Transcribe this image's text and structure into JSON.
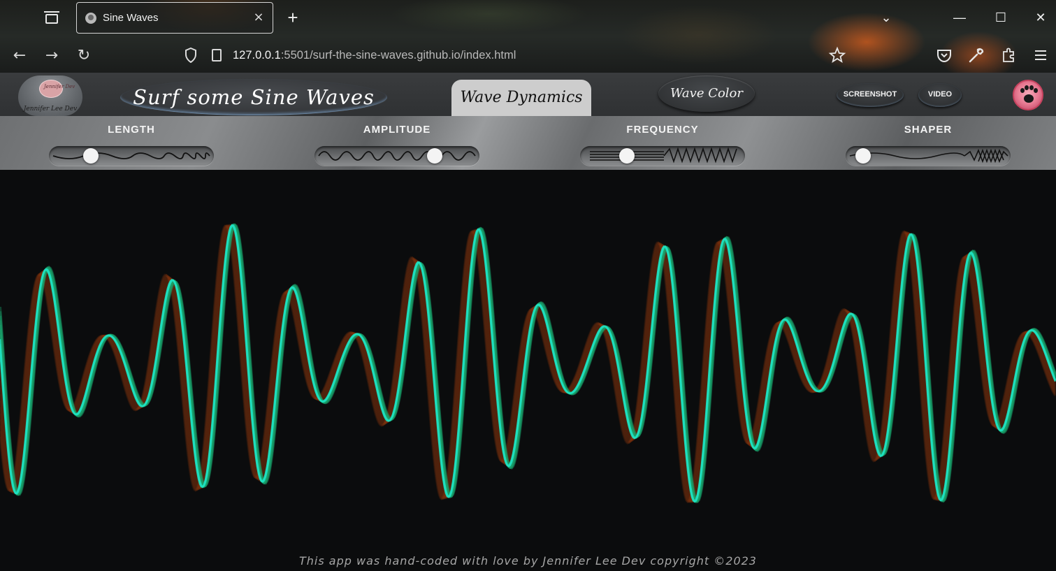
{
  "browser": {
    "tab_title": "Sine Waves",
    "tab_close": "×",
    "new_tab": "+",
    "url_host": "127.0.0.1",
    "url_rest": ":5501/surf-the-sine-waves.github.io/index.html",
    "window_controls": {
      "dropdown": "⌄",
      "minimize": "—",
      "maximize": "☐",
      "close": "✕"
    },
    "nav": {
      "back": "←",
      "forward": "→",
      "reload": "↻"
    },
    "toolbar_icons": [
      "star-icon",
      "pocket-icon",
      "wrench-icon",
      "extensions-icon",
      "menu-icon"
    ]
  },
  "header": {
    "logo_cloud_text": "Jennifer Dev",
    "logo_caption": "Jennifer Lee Dev",
    "title": "Surf some Sine Waves",
    "tabs": [
      {
        "label": "Wave Dynamics",
        "active": true
      },
      {
        "label": "Wave Color",
        "active": false
      }
    ],
    "screenshot_label": "SCREENSHOT",
    "video_label": "VIDEO"
  },
  "controls": [
    {
      "label": "LENGTH",
      "value": 0.22
    },
    {
      "label": "AMPLITUDE",
      "value": 0.76
    },
    {
      "label": "FREQUENCY",
      "value": 0.25
    },
    {
      "label": "SHAPER",
      "value": 0.05
    }
  ],
  "colors": {
    "wave_main": "#1fe0c0",
    "wave_green": "#1aa870",
    "wave_ghost": "#8a3a12",
    "background": "#0b0c0d"
  },
  "footer": "This app was hand-coded with love by Jennifer Lee Dev copyright ©2023"
}
